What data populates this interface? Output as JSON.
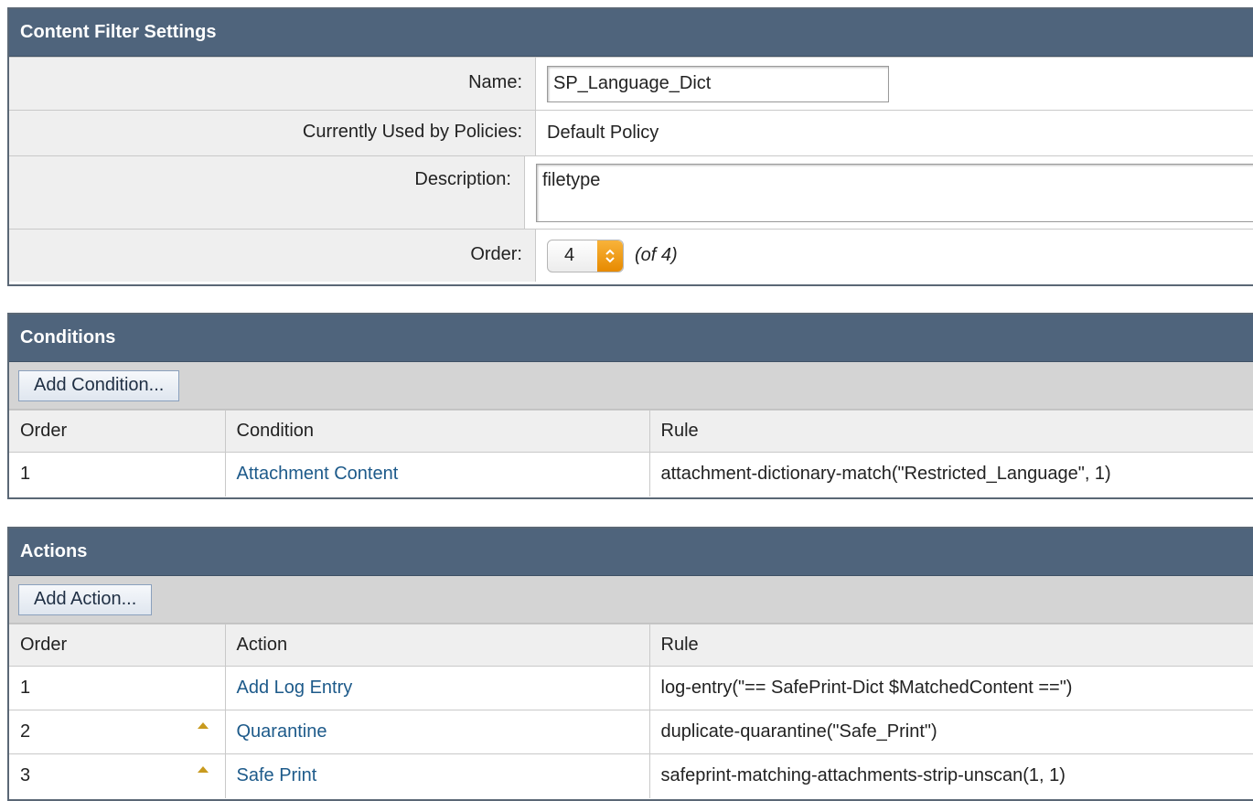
{
  "settings": {
    "title": "Content Filter Settings",
    "name_label": "Name:",
    "name_value": "SP_Language_Dict",
    "policies_label": "Currently Used by Policies:",
    "policies_value": "Default Policy",
    "description_label": "Description:",
    "description_value": "filetype",
    "order_label": "Order:",
    "order_value": "4",
    "order_of": "(of 4)"
  },
  "conditions": {
    "title": "Conditions",
    "add_button": "Add Condition...",
    "headers": [
      "Order",
      "Condition",
      "Rule"
    ],
    "rows": [
      {
        "order": "1",
        "name": "Attachment Content",
        "rule": "attachment-dictionary-match(\"Restricted_Language\", 1)"
      }
    ]
  },
  "actions": {
    "title": "Actions",
    "add_button": "Add Action...",
    "headers": [
      "Order",
      "Action",
      "Rule"
    ],
    "rows": [
      {
        "order": "1",
        "name": "Add Log Entry",
        "rule": "log-entry(\"== SafePrint-Dict $MatchedContent ==\")",
        "move_up": false
      },
      {
        "order": "2",
        "name": "Quarantine",
        "rule": "duplicate-quarantine(\"Safe_Print\")",
        "move_up": true
      },
      {
        "order": "3",
        "name": "Safe Print",
        "rule": "safeprint-matching-attachments-strip-unscan(1, 1)",
        "move_up": true
      }
    ]
  },
  "icons": {
    "select_arrows": "updown-chevron-icon",
    "move_up": "move-up-arrow-icon"
  },
  "colors": {
    "header_bg": "#4f647c",
    "link": "#1d5a8a",
    "select_accent": "#f0a020"
  }
}
